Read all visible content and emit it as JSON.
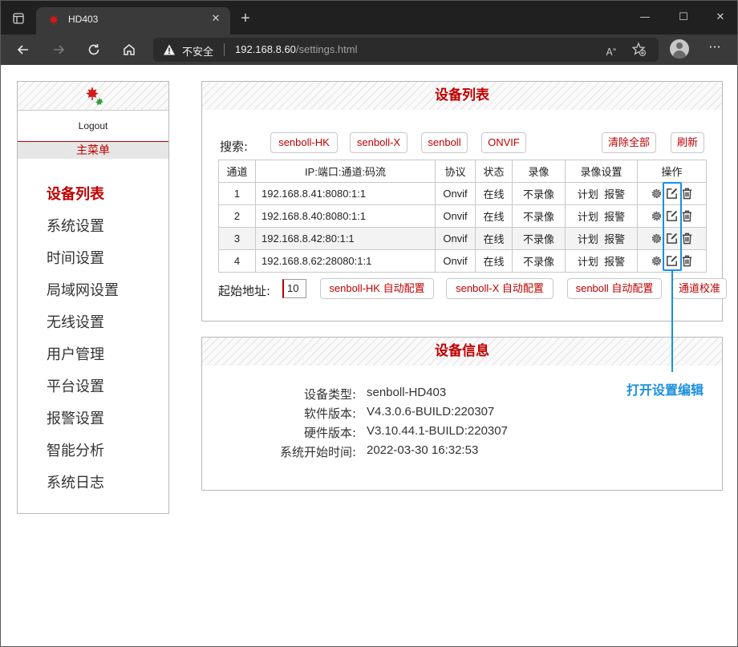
{
  "browser": {
    "tab_title": "HD403",
    "security_label": "不安全",
    "url_host": "192.168.8.60",
    "url_path": "/settings.html"
  },
  "sidebar": {
    "logout_label": "Logout",
    "menu_header": "主菜单",
    "items": [
      {
        "label": "设备列表",
        "active": true
      },
      {
        "label": "系统设置"
      },
      {
        "label": "时间设置"
      },
      {
        "label": "局域网设置"
      },
      {
        "label": "无线设置"
      },
      {
        "label": "用户管理"
      },
      {
        "label": "平台设置"
      },
      {
        "label": "报警设置"
      },
      {
        "label": "智能分析"
      },
      {
        "label": "系统日志"
      }
    ]
  },
  "device_list": {
    "title": "设备列表",
    "search_label": "搜索:",
    "search_chips": [
      "senboll-HK",
      "senboll-X",
      "senboll",
      "ONVIF"
    ],
    "clear_all_label": "清除全部",
    "refresh_label": "刷新",
    "columns": [
      "通道",
      "IP:端口:通道:码流",
      "协议",
      "状态",
      "录像",
      "录像设置",
      "操作"
    ],
    "rows": [
      {
        "channel": "1",
        "address": "192.168.8.41:8080:1:1",
        "protocol": "Onvif",
        "status": "在线",
        "recording": "不录像",
        "schedule": "计划",
        "alarm": "报警"
      },
      {
        "channel": "2",
        "address": "192.168.8.40:8080:1:1",
        "protocol": "Onvif",
        "status": "在线",
        "recording": "不录像",
        "schedule": "计划",
        "alarm": "报警"
      },
      {
        "channel": "3",
        "address": "192.168.8.42:80:1:1",
        "protocol": "Onvif",
        "status": "在线",
        "recording": "不录像",
        "schedule": "计划",
        "alarm": "报警"
      },
      {
        "channel": "4",
        "address": "192.168.8.62:28080:1:1",
        "protocol": "Onvif",
        "status": "在线",
        "recording": "不录像",
        "schedule": "计划",
        "alarm": "报警"
      }
    ],
    "start_address_label": "起始地址:",
    "start_address_value": "10",
    "auto_hk_label": "senboll-HK 自动配置",
    "auto_x_label": "senboll-X 自动配置",
    "auto_senboll_label": "senboll 自动配置",
    "calibrate_label": "通道校准"
  },
  "device_info": {
    "title": "设备信息",
    "rows": [
      {
        "key": "设备类型:",
        "value": "senboll-HD403"
      },
      {
        "key": "软件版本:",
        "value": "V4.3.0.6-BUILD:220307"
      },
      {
        "key": "硬件版本:",
        "value": "V3.10.44.1-BUILD:220307"
      },
      {
        "key": "系统开始时间:",
        "value": "2022-03-30 16:32:53"
      }
    ]
  },
  "annotation": {
    "text": "打开设置编辑",
    "color": "#1a8fe0"
  },
  "colors": {
    "accent": "#c00000",
    "chrome_dark": "#202020"
  }
}
